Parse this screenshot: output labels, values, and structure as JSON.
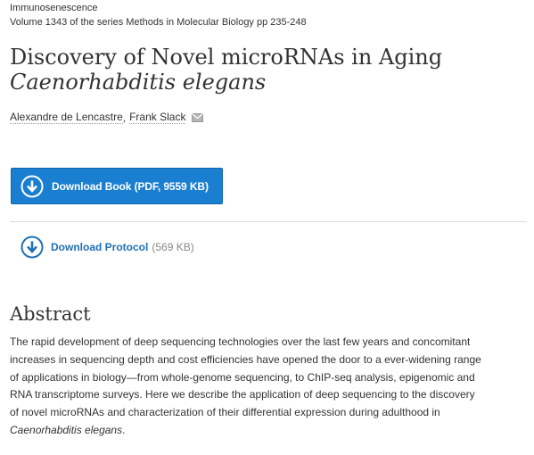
{
  "header": {
    "book_title": "Immunosenescence",
    "series_prefix": "Volume 1343 of the series ",
    "series_name": "Methods in Molecular Biology",
    "pages": " pp 235-248"
  },
  "chapter": {
    "title_line1": "Discovery of Novel microRNAs in Aging",
    "title_line2": "Caenorhabditis elegans"
  },
  "authors": [
    {
      "name": "Alexandre de Lencastre"
    },
    {
      "name": "Frank Slack"
    }
  ],
  "author_separator": ",",
  "download_book": {
    "label": "Download Book (PDF, 9559 KB)",
    "icon": "download-circle-icon",
    "color": "#1a7fd0"
  },
  "download_protocol": {
    "label": "Download Protocol",
    "size": "(569 KB)",
    "icon": "download-circle-icon",
    "color": "#2170b4"
  },
  "abstract": {
    "heading": "Abstract",
    "lines": [
      "The rapid development of deep sequencing technologies over the last few years and concomitant",
      "increases in sequencing depth and cost efficiencies have opened the door to a ever-widening range",
      "of applications in biology—from whole-genome sequencing, to ChIP-seq analysis, epigenomic and",
      "RNA transcriptome surveys. Here we describe the application of deep sequencing to the discovery",
      "of novel microRNAs and characterization of their differential expression during adulthood in"
    ],
    "final_italic": "Caenorhabditis elegans",
    "final_end": "."
  }
}
